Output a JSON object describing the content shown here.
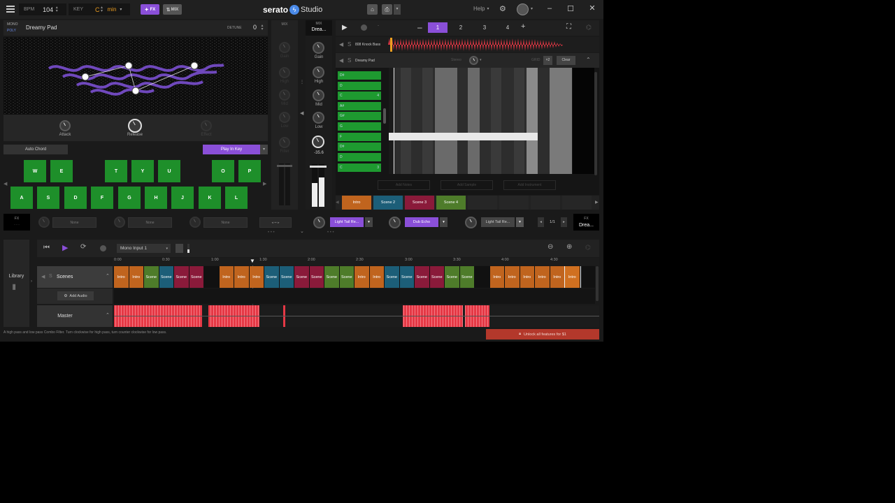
{
  "topbar": {
    "bpm_label": "BPM",
    "bpm_value": "104",
    "key_label": "KEY",
    "key_value": "C",
    "scale_value": "min",
    "fx_label": "FX",
    "mix_label": "MIX",
    "logo_text": "serato",
    "logo_suffix": "Studio",
    "help_label": "Help"
  },
  "instrument": {
    "mono_label": "MONO",
    "poly_label": "POLY",
    "name": "Dreamy Pad",
    "detune_label": "DETUNE",
    "detune_value": "0",
    "knobs": [
      {
        "label": "Attack"
      },
      {
        "label": "Release"
      },
      {
        "label": "Effect"
      }
    ],
    "auto_chord": "Auto Chord",
    "play_in_key": "Play In Key",
    "upper_keys": [
      "W",
      "E",
      "T",
      "Y",
      "U",
      "O",
      "P"
    ],
    "lower_keys": [
      "A",
      "S",
      "D",
      "F",
      "G",
      "H",
      "J",
      "K",
      "L"
    ]
  },
  "mixer": {
    "mix_label": "MIX",
    "channel_label": "MIX",
    "channel_name": "Drea...",
    "knobs": [
      {
        "label": "Gain"
      },
      {
        "label": "High"
      },
      {
        "label": "Mid"
      },
      {
        "label": "Low"
      }
    ],
    "filter_value": "-35.6",
    "dim_labels": [
      "Gain",
      "High",
      "Mid",
      "Low",
      "Filter"
    ]
  },
  "pattern": {
    "numbers": [
      "1",
      "2",
      "3",
      "4"
    ],
    "tracks": [
      {
        "name": "808 Knock Bass"
      },
      {
        "name": "Dreamy Pad"
      }
    ],
    "stereo_label": "Stereo",
    "grid_label": "GRID",
    "grid_value": "×2",
    "clear_label": "Clear",
    "notes": [
      {
        "name": "D#",
        "oct": ""
      },
      {
        "name": "D",
        "oct": ""
      },
      {
        "name": "C",
        "oct": "4"
      },
      {
        "name": "A#",
        "oct": ""
      },
      {
        "name": "G#",
        "oct": ""
      },
      {
        "name": "G",
        "oct": ""
      },
      {
        "name": "F",
        "oct": ""
      },
      {
        "name": "D#",
        "oct": ""
      },
      {
        "name": "D",
        "oct": ""
      },
      {
        "name": "C",
        "oct": "3"
      }
    ],
    "bottom_buttons": [
      "Add Notes",
      "Add Sample",
      "Add Instrument"
    ]
  },
  "scenes_row": [
    "Intro",
    "Scene 2",
    "Scene 3",
    "Scene 4"
  ],
  "fx_row": {
    "fx_label": "FX",
    "slots": [
      "None",
      "None",
      "None"
    ],
    "effects": [
      "Light Tail Re...",
      "Dub Echo",
      "Light Tail Re..."
    ],
    "page": "1/1",
    "fx_right_label": "FX",
    "fx_right_name": "Drea..."
  },
  "transport": {
    "input_select": "Mono Input 1"
  },
  "timeline": {
    "library_label": "Library",
    "ticks": [
      "0:00",
      "0:30",
      "1:00",
      "1:30",
      "2:00",
      "2:30",
      "3:00",
      "3:30",
      "4:00",
      "4:30"
    ],
    "scenes_track": "Scenes",
    "add_audio": "Add Audio",
    "master_track": "Master",
    "blocks": [
      {
        "label": "Intro",
        "color": "#c0641e"
      },
      {
        "label": "Intro",
        "color": "#c0641e"
      },
      {
        "label": "Scene",
        "color": "#4e7c2a"
      },
      {
        "label": "Scene",
        "color": "#1c5e78"
      },
      {
        "label": "Scene",
        "color": "#8a1a3a"
      },
      {
        "label": "Scene",
        "color": "#8a1a3a"
      },
      {
        "label": "",
        "color": "#111111"
      },
      {
        "label": "Intro",
        "color": "#c0641e"
      },
      {
        "label": "Intro",
        "color": "#c0641e"
      },
      {
        "label": "Intro",
        "color": "#c0641e"
      },
      {
        "label": "Scene",
        "color": "#1c5e78"
      },
      {
        "label": "Scene",
        "color": "#1c5e78"
      },
      {
        "label": "Scene",
        "color": "#8a1a3a"
      },
      {
        "label": "Scene",
        "color": "#8a1a3a"
      },
      {
        "label": "Scene",
        "color": "#4e7c2a"
      },
      {
        "label": "Scene",
        "color": "#4e7c2a"
      },
      {
        "label": "Intro",
        "color": "#c0641e"
      },
      {
        "label": "Intro",
        "color": "#c0641e"
      },
      {
        "label": "Scene",
        "color": "#1c5e78"
      },
      {
        "label": "Scene",
        "color": "#1c5e78"
      },
      {
        "label": "Scene",
        "color": "#8a1a3a"
      },
      {
        "label": "Scene",
        "color": "#8a1a3a"
      },
      {
        "label": "Scene",
        "color": "#4e7c2a"
      },
      {
        "label": "Scene",
        "color": "#4e7c2a"
      },
      {
        "label": "",
        "color": "#111111"
      },
      {
        "label": "Intro",
        "color": "#c0641e"
      },
      {
        "label": "Intro",
        "color": "#c0641e"
      },
      {
        "label": "Intro",
        "color": "#c0641e"
      },
      {
        "label": "Intro",
        "color": "#c0641e"
      },
      {
        "label": "Intro",
        "color": "#c0641e"
      },
      {
        "label": "Intro",
        "color": "#d07020"
      }
    ]
  },
  "status": {
    "hint": "A high pass and low pass Combo Filter. Turn clockwise for high pass, turn counter clockwise for low pass.",
    "unlock": "Unlock all features for $1"
  },
  "colors": {
    "purple": "#8a4fd8",
    "green_key": "#1e8f2a",
    "wave_red": "#e53845",
    "scene_teal": "#1c5e78",
    "scene_crimson": "#8a1a3a",
    "scene_olive": "#4e7c2a",
    "intro_orange": "#c0641e"
  }
}
